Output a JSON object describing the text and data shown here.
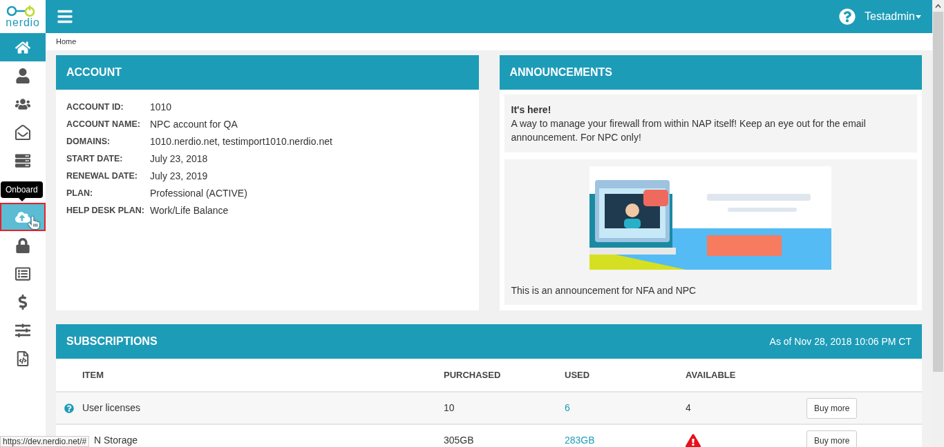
{
  "logo": {
    "text": "nerdio"
  },
  "top_bar": {
    "user": "Testadmin"
  },
  "sidebar": {
    "items": [
      {
        "selected": true,
        "hovered": false
      },
      {
        "selected": false,
        "hovered": false
      },
      {
        "selected": false,
        "hovered": false
      },
      {
        "selected": false,
        "hovered": false
      },
      {
        "selected": false,
        "hovered": false
      },
      {
        "selected": false,
        "hovered": true
      },
      {
        "selected": false,
        "hovered": false
      },
      {
        "selected": false,
        "hovered": false
      },
      {
        "selected": false,
        "hovered": false
      },
      {
        "selected": false,
        "hovered": false
      },
      {
        "selected": false,
        "hovered": false
      }
    ],
    "tooltip": "Onboard"
  },
  "breadcrumb": "Home",
  "account": {
    "title": "ACCOUNT",
    "fields": [
      {
        "label": "ACCOUNT ID:",
        "value": "1010"
      },
      {
        "label": "ACCOUNT NAME:",
        "value": "NPC account for QA"
      },
      {
        "label": "DOMAINS:",
        "value": "1010.nerdio.net, testimport1010.nerdio.net"
      },
      {
        "label": "START DATE:",
        "value": "July 23, 2018"
      },
      {
        "label": "RENEWAL DATE:",
        "value": "July 23, 2019"
      },
      {
        "label": "PLAN:",
        "value": "Professional (ACTIVE)"
      },
      {
        "label": "HELP DESK PLAN:",
        "value": "Work/Life Balance"
      }
    ]
  },
  "announcements": {
    "title": "ANNOUNCEMENTS",
    "items": [
      {
        "kind": "text",
        "heading": "It's here!",
        "body": "A way to manage your firewall from within NAP itself! Keep an eye out for the email announcement. For NPC only!"
      },
      {
        "kind": "banner",
        "body": "This is an announcement for NFA and NPC"
      }
    ]
  },
  "subscriptions": {
    "title": "SUBSCRIPTIONS",
    "as_of": "As of Nov 28, 2018 10:06 PM CT",
    "columns": [
      "ITEM",
      "PURCHASED",
      "USED",
      "AVAILABLE"
    ],
    "rows": [
      {
        "item": "User licenses",
        "purchased": "10",
        "used": "6",
        "available": "4",
        "help": true,
        "warning": false,
        "button": "Buy more"
      },
      {
        "item": "N Storage",
        "purchased": "305GB",
        "used": "283GB",
        "available": "",
        "help": false,
        "warning": true,
        "button": "Buy more"
      }
    ]
  },
  "status_url": "https://dev.nerdio.net/#"
}
